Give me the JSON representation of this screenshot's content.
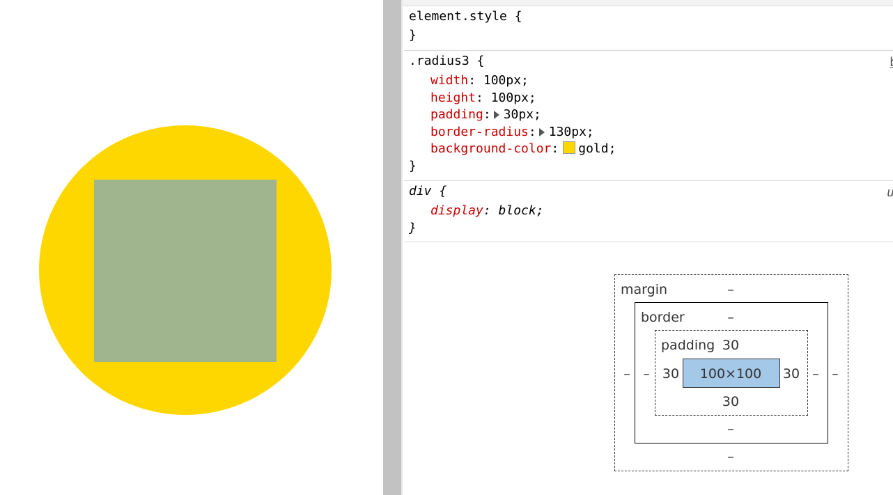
{
  "preview": {
    "circle_color": "#FFD700",
    "content_color": "#A0B58E"
  },
  "styles": {
    "element_style": {
      "selector": "element.style {",
      "close": "}"
    },
    "radius3": {
      "selector": ".radius3 {",
      "source": "b",
      "declarations": [
        {
          "prop": "width",
          "value": "100px;"
        },
        {
          "prop": "height",
          "value": "100px;"
        },
        {
          "prop": "padding",
          "value": "30px;"
        },
        {
          "prop": "border-radius",
          "value": "130px;"
        },
        {
          "prop": "background-color",
          "value": "gold;"
        }
      ],
      "close": "}"
    },
    "div_rule": {
      "selector": "div {",
      "source": "u",
      "declarations": [
        {
          "prop": "display",
          "value": "block;"
        }
      ],
      "close": "}"
    }
  },
  "box_model": {
    "margin_label": "margin",
    "border_label": "border",
    "padding_label": "padding",
    "margin": {
      "top": "–",
      "right": "–",
      "bottom": "–",
      "left": "–"
    },
    "border": {
      "top": "–",
      "right": "–",
      "bottom": "–",
      "left": "–"
    },
    "padding": {
      "top": "30",
      "right": "30",
      "bottom": "30",
      "left": "30"
    },
    "content": "100×100"
  }
}
